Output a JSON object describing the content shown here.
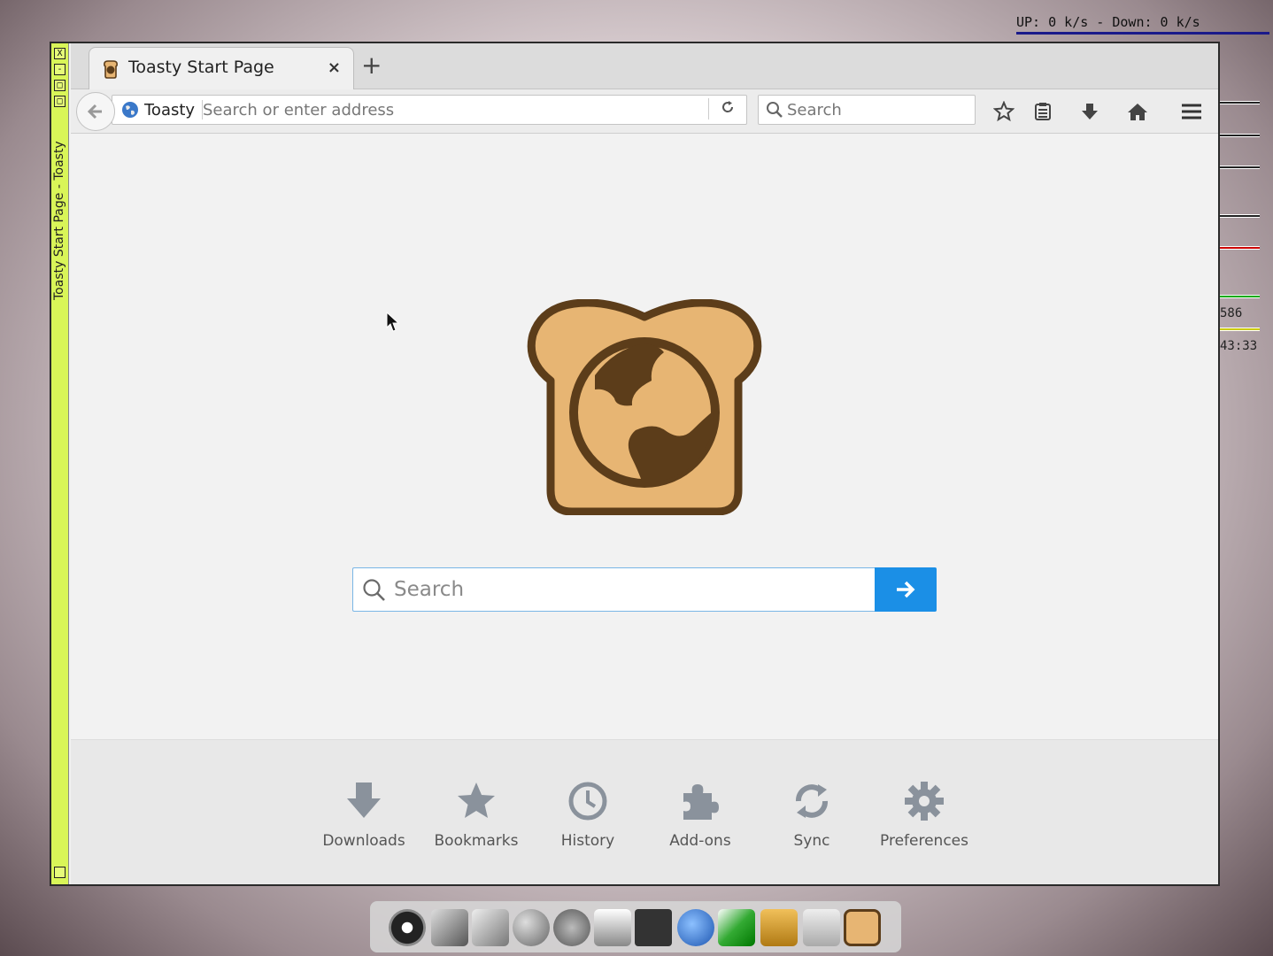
{
  "desktop": {
    "net_monitor": "UP: 0 k/s - Down: 0 k/s",
    "side_text_1": "586",
    "side_text_2": "43:33"
  },
  "window": {
    "title": "Toasty Start Page - Toasty",
    "buttons": [
      "X",
      "-",
      "□",
      "□"
    ]
  },
  "tabs": [
    {
      "label": "Toasty Start Page",
      "close": "×"
    }
  ],
  "newtab_label": "+",
  "navbar": {
    "identity_label": "Toasty",
    "url_placeholder": "Search or enter address",
    "search_placeholder": "Search"
  },
  "content": {
    "search_placeholder": "Search"
  },
  "launcher": {
    "items": [
      {
        "label": "Downloads",
        "icon": "download-icon"
      },
      {
        "label": "Bookmarks",
        "icon": "star-icon"
      },
      {
        "label": "History",
        "icon": "clock-icon"
      },
      {
        "label": "Add-ons",
        "icon": "puzzle-icon"
      },
      {
        "label": "Sync",
        "icon": "sync-icon"
      },
      {
        "label": "Preferences",
        "icon": "gear-icon"
      }
    ]
  },
  "colors": {
    "accent": "#1b8fe6",
    "window_border": "#d9f558",
    "toast_crust": "#5c3d1a",
    "toast_bread": "#e7b573",
    "icon_gray": "#8a929c"
  }
}
